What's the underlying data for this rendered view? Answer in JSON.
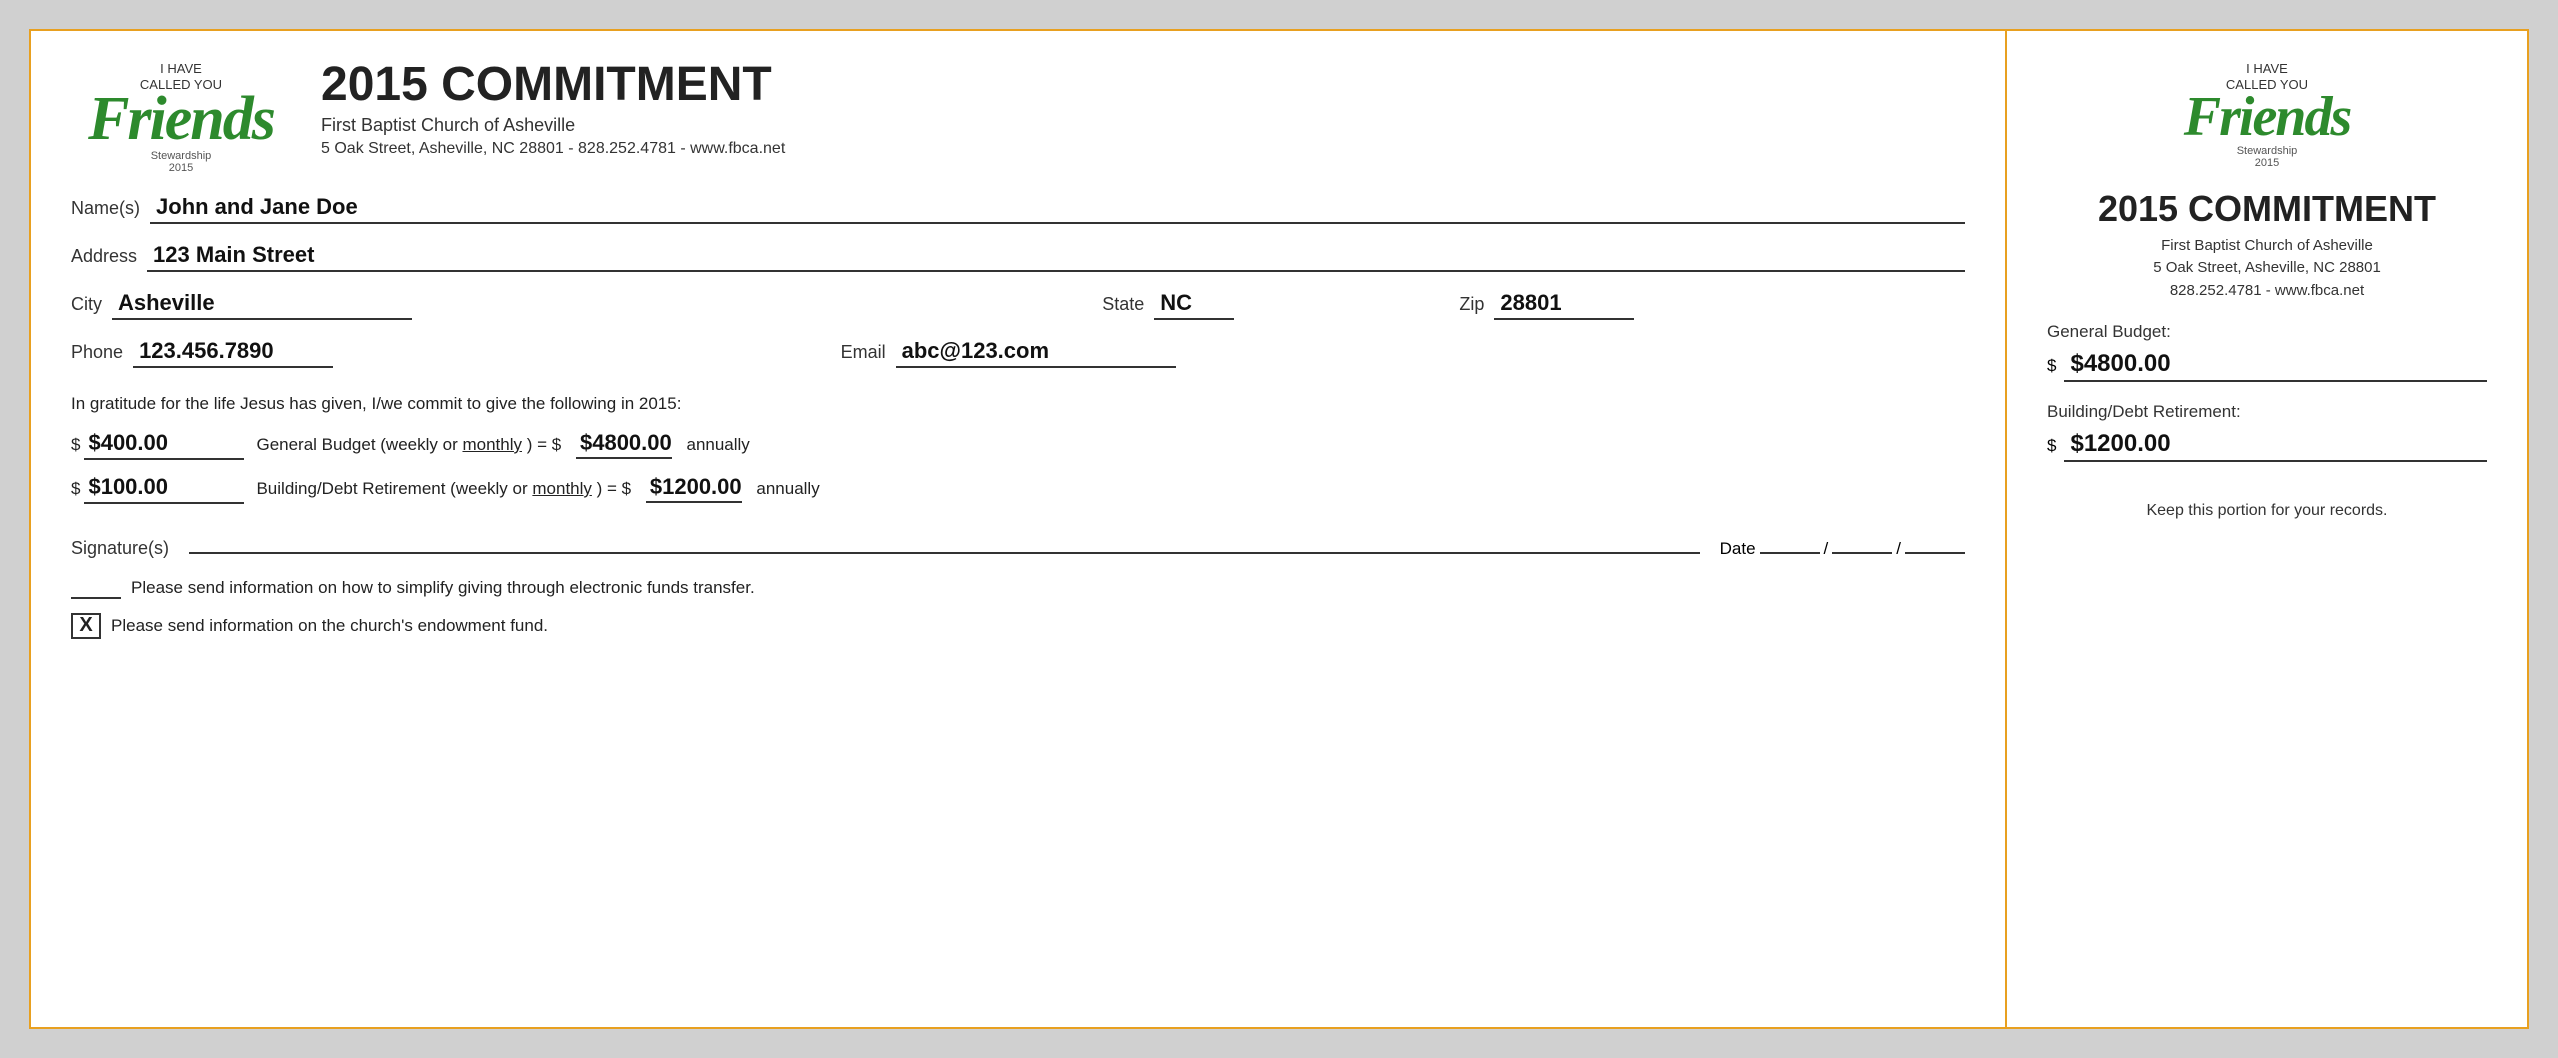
{
  "header": {
    "logo": {
      "i_have": "I HAVE",
      "called_you": "CALLED YOU",
      "friends": "Friends",
      "stewardship": "Stewardship",
      "year": "2015"
    },
    "title": "2015 COMMITMENT",
    "church_name": "First Baptist Church of Asheville",
    "address_line": "5 Oak Street, Asheville, NC  28801 - 828.252.4781 - www.fbca.net"
  },
  "form": {
    "name_label": "Name(s)",
    "name_value": "John and Jane Doe",
    "address_label": "Address",
    "address_value": "123 Main Street",
    "city_label": "City",
    "city_value": "Asheville",
    "state_label": "State",
    "state_value": "NC",
    "zip_label": "Zip",
    "zip_value": "28801",
    "phone_label": "Phone",
    "phone_value": "123.456.7890",
    "email_label": "Email",
    "email_value": "abc@123.com",
    "gratitude_text": "In gratitude for the life Jesus has given, I/we commit to give the following in 2015:",
    "general_budget_amount": "$400.00",
    "general_budget_desc": "General Budget (weekly or",
    "general_budget_monthly": "monthly",
    "general_budget_eq": ") = $",
    "general_budget_annual": "$4800.00",
    "general_budget_annually": "annually",
    "building_amount": "$100.00",
    "building_desc": "Building/Debt Retirement (weekly or",
    "building_monthly": "monthly",
    "building_eq": ") = $",
    "building_annual": "$1200.00",
    "building_annually": "annually",
    "signature_label": "Signature(s)",
    "date_label": "Date",
    "checkbox1_text": "Please send information on how to simplify giving through electronic funds transfer.",
    "checkbox2_text": "Please send information on the church's endowment fund.",
    "checkbox2_checked": "X"
  },
  "stub": {
    "logo": {
      "i_have": "I HAVE",
      "called_you": "CALLED YOU",
      "friends": "Friends",
      "stewardship": "Stewardship",
      "year": "2015"
    },
    "title": "2015 COMMITMENT",
    "church_name": "First Baptist Church of Asheville",
    "address": "5 Oak Street, Asheville, NC  28801",
    "contact": "828.252.4781 - www.fbca.net",
    "general_budget_label": "General Budget:",
    "general_budget_amount": "$4800.00",
    "building_label": "Building/Debt Retirement:",
    "building_amount": "$1200.00",
    "footer": "Keep this portion for your records."
  }
}
